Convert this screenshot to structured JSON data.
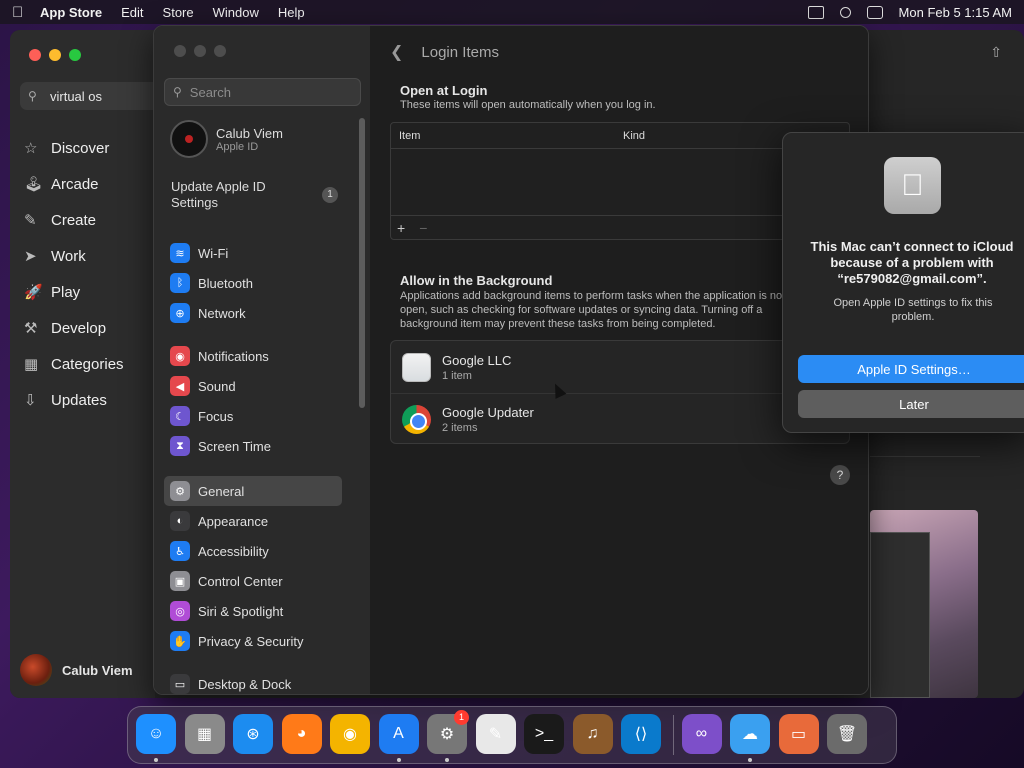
{
  "menubar": {
    "app_name": "App Store",
    "menus": [
      "Edit",
      "Store",
      "Window",
      "Help"
    ],
    "clock": "Mon Feb 5  1:15 AM"
  },
  "appstore": {
    "search_value": "virtual os",
    "nav": [
      {
        "label": "Discover",
        "icon": "star-icon",
        "glyph": "☆"
      },
      {
        "label": "Arcade",
        "icon": "joystick-icon",
        "glyph": "🕹"
      },
      {
        "label": "Create",
        "icon": "brush-icon",
        "glyph": "✎"
      },
      {
        "label": "Work",
        "icon": "paperplane-icon",
        "glyph": "➤"
      },
      {
        "label": "Play",
        "icon": "rocket-icon",
        "glyph": "🚀"
      },
      {
        "label": "Develop",
        "icon": "hammer-icon",
        "glyph": "⚒"
      },
      {
        "label": "Categories",
        "icon": "grid-icon",
        "glyph": "▦"
      },
      {
        "label": "Updates",
        "icon": "download-icon",
        "glyph": "⇩"
      }
    ],
    "user_name": "Calub Viem"
  },
  "settings": {
    "search_placeholder": "Search",
    "account_name": "Calub Viem",
    "account_sub": "Apple ID",
    "update_label": "Update Apple ID Settings",
    "update_badge": "1",
    "groups": [
      [
        {
          "label": "Wi-Fi",
          "icon": "wifi-icon",
          "color": "#1e7cf2",
          "glyph": "≋"
        },
        {
          "label": "Bluetooth",
          "icon": "bluetooth-icon",
          "color": "#1e7cf2",
          "glyph": "ᛒ"
        },
        {
          "label": "Network",
          "icon": "globe-icon",
          "color": "#1e7cf2",
          "glyph": "⊕"
        }
      ],
      [
        {
          "label": "Notifications",
          "icon": "bell-icon",
          "color": "#e5484d",
          "glyph": "◉"
        },
        {
          "label": "Sound",
          "icon": "speaker-icon",
          "color": "#e5484d",
          "glyph": "◀"
        },
        {
          "label": "Focus",
          "icon": "moon-icon",
          "color": "#6e56cf",
          "glyph": "☾"
        },
        {
          "label": "Screen Time",
          "icon": "hourglass-icon",
          "color": "#6e56cf",
          "glyph": "⧗"
        }
      ],
      [
        {
          "label": "General",
          "icon": "gear-icon",
          "color": "#8e8e93",
          "glyph": "⚙",
          "selected": true
        },
        {
          "label": "Appearance",
          "icon": "appearance-icon",
          "color": "#3a3a3c",
          "glyph": "◐"
        },
        {
          "label": "Accessibility",
          "icon": "accessibility-icon",
          "color": "#1e7cf2",
          "glyph": "♿"
        },
        {
          "label": "Control Center",
          "icon": "control-center-icon",
          "color": "#8e8e93",
          "glyph": "▣"
        },
        {
          "label": "Siri & Spotlight",
          "icon": "siri-icon",
          "color": "#b04cd6",
          "glyph": "◎"
        },
        {
          "label": "Privacy & Security",
          "icon": "hand-icon",
          "color": "#1e7cf2",
          "glyph": "✋"
        }
      ],
      [
        {
          "label": "Desktop & Dock",
          "icon": "dock-icon",
          "color": "#3a3a3c",
          "glyph": "▭"
        }
      ]
    ],
    "page_title": "Login Items",
    "open_at_login_title": "Open at Login",
    "open_at_login_desc": "These items will open automatically when you log in.",
    "table_headers": [
      "Item",
      "Kind"
    ],
    "add_label": "+",
    "remove_label": "−",
    "background_title": "Allow in the Background",
    "background_desc": "Applications add background items to perform tasks when the application is not open, such as checking for software updates or syncing data. Turning off a background item may prevent these tasks from being completed.",
    "background_items": [
      {
        "name": "Google LLC",
        "count": "1 item",
        "icon": "google-llc-icon",
        "kind": "google"
      },
      {
        "name": "Google Updater",
        "count": "2 items",
        "icon": "chrome-icon",
        "kind": "chrome"
      }
    ],
    "help_label": "?"
  },
  "dialog": {
    "title": "This Mac can’t connect to iCloud because of a problem with “re579082@gmail.com”.",
    "message": "Open Apple ID settings to fix this problem.",
    "primary_button": "Apple ID Settings…",
    "secondary_button": "Later"
  },
  "dock": {
    "apps": [
      {
        "name": "finder-icon",
        "color": "#1e90ff",
        "glyph": "☺",
        "running": true
      },
      {
        "name": "launchpad-icon",
        "color": "#8a8a8a",
        "glyph": "▦",
        "running": false
      },
      {
        "name": "safari-icon",
        "color": "#1c8cf0",
        "glyph": "⊛",
        "running": false
      },
      {
        "name": "firefox-icon",
        "color": "#ff7a18",
        "glyph": "◕",
        "running": false
      },
      {
        "name": "chrome-icon",
        "color": "#f4b400",
        "glyph": "◉",
        "running": false
      },
      {
        "name": "app-store-icon",
        "color": "#1e7cf2",
        "glyph": "A",
        "running": true
      },
      {
        "name": "system-settings-icon",
        "color": "#777",
        "glyph": "⚙",
        "running": true,
        "badge": "1"
      },
      {
        "name": "textedit-icon",
        "color": "#e8e8e8",
        "glyph": "✎",
        "running": false
      },
      {
        "name": "terminal-icon",
        "color": "#1a1a1a",
        "glyph": ">_",
        "running": false
      },
      {
        "name": "garageband-icon",
        "color": "#8b5a2b",
        "glyph": "♫",
        "running": false
      },
      {
        "name": "vscode-icon",
        "color": "#0a7acc",
        "glyph": "⟨⟩",
        "running": false
      },
      {
        "name": "visual-studio-icon",
        "color": "#7d4fc9",
        "glyph": "∞",
        "running": false
      },
      {
        "name": "weather-icon",
        "color": "#3aa0f0",
        "glyph": "☁",
        "running": true
      },
      {
        "name": "vm-icon",
        "color": "#e86a3a",
        "glyph": "▭",
        "running": false
      },
      {
        "name": "trash-icon",
        "color": "#6b6b6b",
        "glyph": "🗑",
        "running": false
      }
    ]
  }
}
